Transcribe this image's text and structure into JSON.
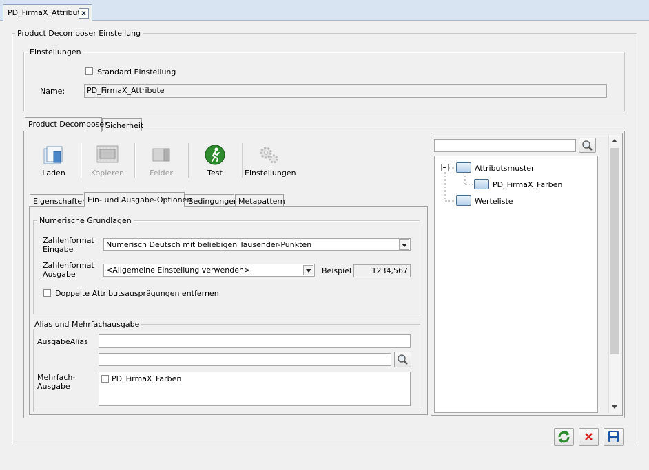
{
  "document_tab": {
    "title": "PD_FirmaX_Attribute",
    "close_label": "x"
  },
  "main_group": {
    "title": "Product Decomposer Einstellung"
  },
  "settings": {
    "title": "Einstellungen",
    "standard_checkbox_label": "Standard Einstellung",
    "name_label": "Name:",
    "name_value": "PD_FirmaX_Attribute"
  },
  "outer_tabs": [
    {
      "label": "Product Decomposer"
    },
    {
      "label": "Sicherheit"
    }
  ],
  "toolbar": {
    "load": "Laden",
    "copy": "Kopieren",
    "fields": "Felder",
    "test": "Test",
    "settings": "Einstellungen"
  },
  "inner_tabs": [
    {
      "label": "Eigenschaften"
    },
    {
      "label": "Ein- und Ausgabe-Optionen"
    },
    {
      "label": "Bedingungen"
    },
    {
      "label": "Metapattern"
    }
  ],
  "numeric": {
    "title": "Numerische Grundlagen",
    "input_format_label_1": "Zahlenformat",
    "input_format_label_2": "Eingabe",
    "input_format_value": "Numerisch Deutsch mit beliebigen Tausender-Punkten",
    "output_format_label_1": "Zahlenformat",
    "output_format_label_2": "Ausgabe",
    "output_format_value": "<Allgemeine Einstellung verwenden>",
    "example_label": "Beispiel",
    "example_value": "1234,567",
    "dedupe_label": "Doppelte Attributsausprägungen entfernen"
  },
  "alias": {
    "title": "Alias und Mehrfachausgabe",
    "output_alias_label": "AusgabeAlias",
    "output_alias_value": "",
    "search_value": "",
    "multi_label_1": "Mehrfach-",
    "multi_label_2": "Ausgabe",
    "multi_items": [
      {
        "label": "PD_FirmaX_Farben",
        "checked": false
      }
    ]
  },
  "tree": {
    "search_value": "",
    "root": "Attributsmuster",
    "child": "PD_FirmaX_Farben",
    "second_root": "Werteliste"
  },
  "colors": {
    "accent_green": "#2e8b2e",
    "cancel_red": "#d6201f",
    "save_blue": "#1f57a8"
  }
}
